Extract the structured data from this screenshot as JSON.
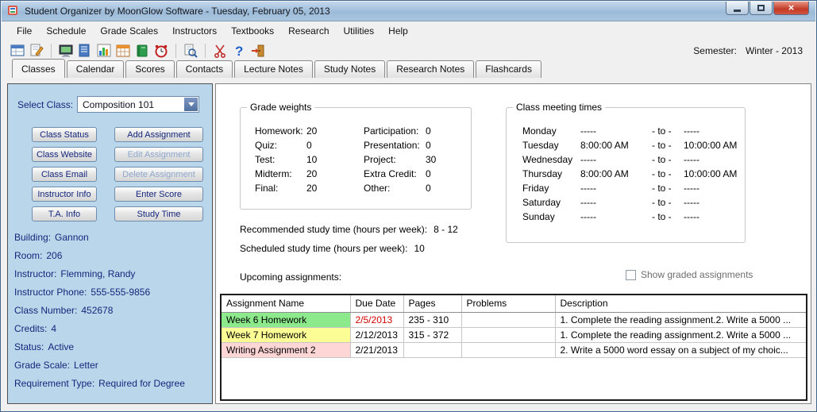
{
  "window": {
    "title": "Student Organizer by MoonGlow Software  -  Tuesday, February 05, 2013",
    "controls": [
      "minimize",
      "maximize",
      "close"
    ],
    "close_glyph": "×"
  },
  "menu": {
    "items": [
      "File",
      "Schedule",
      "Grade Scales",
      "Instructors",
      "Textbooks",
      "Research",
      "Utilities",
      "Help"
    ]
  },
  "toolbar": {
    "icons": [
      "organizer-icon",
      "edit-entry-icon",
      "schedule-icon",
      "class-notes-icon",
      "scores-chart-icon",
      "planner-grid-icon",
      "textbooks-icon",
      "reminder-clock-icon",
      "search-icon",
      "cut-icon",
      "help-icon",
      "exit-icon"
    ],
    "semester_label": "Semester:",
    "semester_value": "Winter - 2013"
  },
  "tabs": [
    {
      "label": "Classes",
      "active": true
    },
    {
      "label": "Calendar",
      "active": false
    },
    {
      "label": "Scores",
      "active": false
    },
    {
      "label": "Contacts",
      "active": false
    },
    {
      "label": "Lecture Notes",
      "active": false
    },
    {
      "label": "Study Notes",
      "active": false
    },
    {
      "label": "Research Notes",
      "active": false
    },
    {
      "label": "Flashcards",
      "active": false
    }
  ],
  "sidebar": {
    "select_class": {
      "label": "Select Class:",
      "value": "Composition 101"
    },
    "action_buttons_left": [
      "Class Status",
      "Class Website",
      "Class Email",
      "Instructor Info",
      "T.A. Info"
    ],
    "action_buttons_right": [
      {
        "label": "Add Assignment",
        "enabled": true
      },
      {
        "label": "Edit Assignment",
        "enabled": false
      },
      {
        "label": "Delete Assignment",
        "enabled": false
      },
      {
        "label": "Enter Score",
        "enabled": true
      },
      {
        "label": "Study Time",
        "enabled": true
      }
    ],
    "info": [
      {
        "label": "Building:",
        "value": "Gannon"
      },
      {
        "label": "Room:",
        "value": "206"
      },
      {
        "label": "Instructor:",
        "value": "Flemming, Randy"
      },
      {
        "label": "Instructor Phone:",
        "value": "555-555-9856"
      },
      {
        "label": "Class Number:",
        "value": "452678"
      },
      {
        "label": "Credits:",
        "value": "4"
      },
      {
        "label": "Status:",
        "value": "Active"
      },
      {
        "label": "Grade Scale:",
        "value": "Letter"
      },
      {
        "label": "Requirement Type:",
        "value": "Required for Degree"
      }
    ],
    "accent_bg": "#b9d6ea",
    "text_color": "#15277c"
  },
  "main": {
    "grade_weights": {
      "title": "Grade weights",
      "left": [
        {
          "label": "Homework:",
          "value": "20"
        },
        {
          "label": "Quiz:",
          "value": "0"
        },
        {
          "label": "Test:",
          "value": "10"
        },
        {
          "label": "Midterm:",
          "value": "20"
        },
        {
          "label": "Final:",
          "value": "20"
        }
      ],
      "right": [
        {
          "label": "Participation:",
          "value": "0"
        },
        {
          "label": "Presentation:",
          "value": "0"
        },
        {
          "label": "Project:",
          "value": "30"
        },
        {
          "label": "Extra Credit:",
          "value": "0"
        },
        {
          "label": "Other:",
          "value": "0"
        }
      ]
    },
    "meeting_times": {
      "title": "Class meeting times",
      "separator": "- to -",
      "rows": [
        {
          "day": "Monday",
          "start": "-----",
          "end": "-----"
        },
        {
          "day": "Tuesday",
          "start": "8:00:00 AM",
          "end": "10:00:00 AM"
        },
        {
          "day": "Wednesday",
          "start": "-----",
          "end": "-----"
        },
        {
          "day": "Thursday",
          "start": "8:00:00 AM",
          "end": "10:00:00 AM"
        },
        {
          "day": "Friday",
          "start": "-----",
          "end": "-----"
        },
        {
          "day": "Saturday",
          "start": "-----",
          "end": "-----"
        },
        {
          "day": "Sunday",
          "start": "-----",
          "end": "-----"
        }
      ]
    },
    "recommended_study": {
      "label": "Recommended study time (hours per week):",
      "value": "8 - 12"
    },
    "scheduled_study": {
      "label": "Scheduled study time (hours per week):",
      "value": "10"
    },
    "upcoming_label": "Upcoming assignments:",
    "show_graded": {
      "label": "Show graded assignments",
      "checked": false
    },
    "assignments": {
      "columns": [
        "Assignment Name",
        "Due Date",
        "Pages",
        "Problems",
        "Description"
      ],
      "rows": [
        {
          "name": "Week 6 Homework",
          "due": "2/5/2013",
          "pages": "235 - 310",
          "problems": "",
          "description": "1. Complete the reading assignment.2. Write a 5000 ...",
          "name_bg": "#8ce98c",
          "due_color": "#d40000"
        },
        {
          "name": "Week 7 Homework",
          "due": "2/12/2013",
          "pages": "315 - 372",
          "problems": "",
          "description": "1. Complete the reading assignment.2. Write a 5000 ...",
          "name_bg": "#fdfd96",
          "due_color": "#000000"
        },
        {
          "name": "Writing Assignment 2",
          "due": "2/21/2013",
          "pages": "",
          "problems": "",
          "description": "2. Write a 5000 word essay on a subject of my choic...",
          "name_bg": "#ffd6d6",
          "due_color": "#000000"
        }
      ]
    }
  }
}
